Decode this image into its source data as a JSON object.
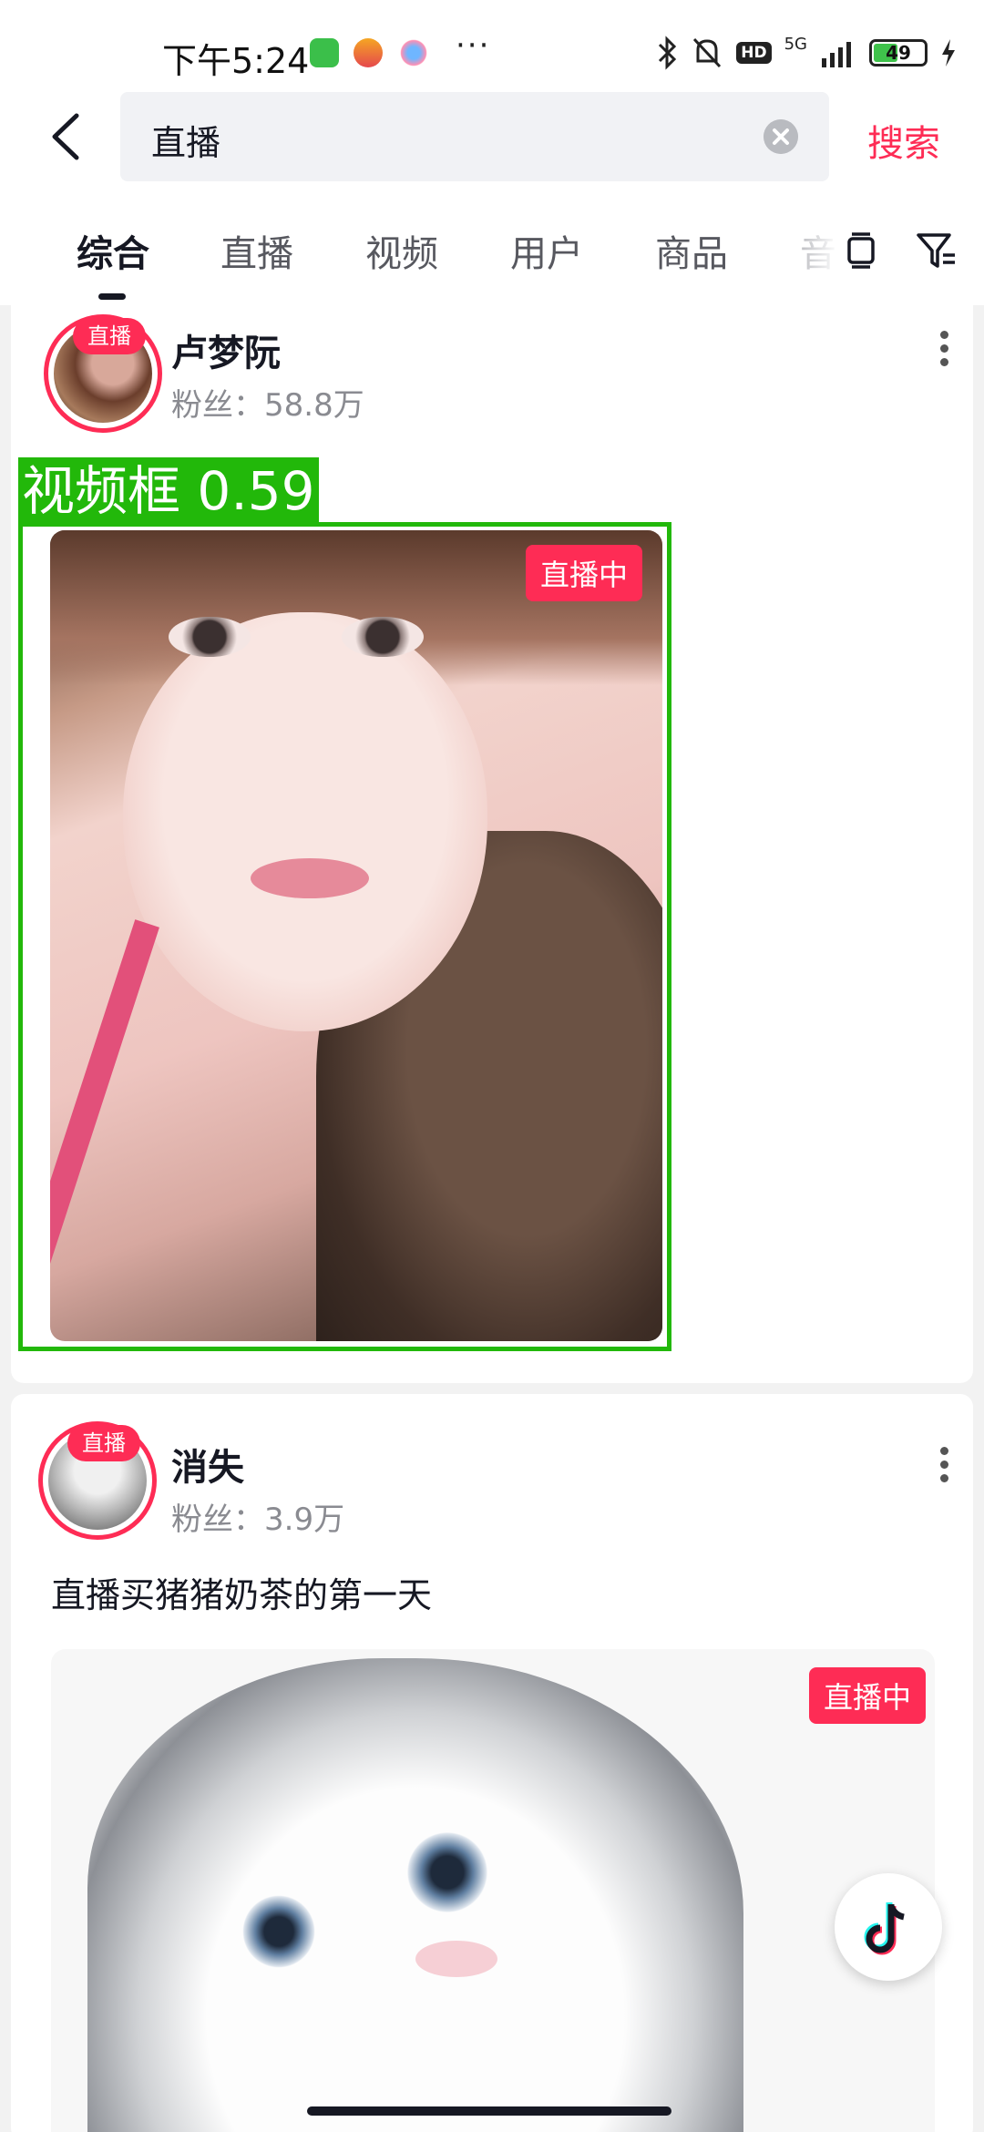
{
  "status_bar": {
    "time": "下午5:24",
    "more": "···",
    "hd": "HD",
    "network": "5G",
    "battery": "49",
    "battery_level": 0.49,
    "colors": {
      "battery_fill": "#3fc24b"
    }
  },
  "header": {
    "back_icon": "chevron-left-icon",
    "search_value": "直播",
    "clear_icon": "close-circle-icon",
    "search_button": "搜索"
  },
  "tabs": {
    "items": [
      "综合",
      "直播",
      "视频",
      "用户",
      "商品",
      "音"
    ],
    "active_index": 0,
    "layout_icon": "card-layout-icon",
    "filter_icon": "filter-icon"
  },
  "results": [
    {
      "username": "卢梦阮",
      "fans": "粉丝：58.8万",
      "avatar_badge": "直播",
      "description": "",
      "live_badge": "直播中"
    },
    {
      "username": "消失",
      "fans": "粉丝：3.9万",
      "avatar_badge": "直播",
      "description": "直播买猪猪奶茶的第一天",
      "live_badge": "直播中"
    }
  ],
  "detection": {
    "label": "视频框 0.59"
  },
  "fab_icon": "douyin-logo-icon",
  "colors": {
    "accent": "#fe2c55",
    "detection": "#22b80a"
  }
}
